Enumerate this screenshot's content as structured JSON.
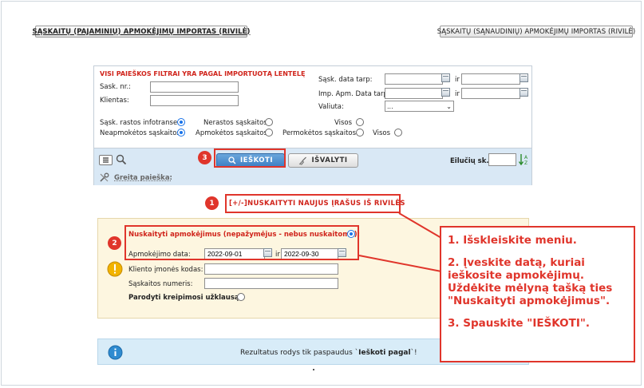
{
  "top": {
    "left_button": "SĄSKAITŲ (PAJAMINIŲ) APMOKĖJIMŲ IMPORTAS (RIVILĖ)",
    "right_button": "SĄSKAITŲ (SĄNAUDINIŲ) APMOKĖJIMŲ IMPORTAS (RIVILĖ)"
  },
  "filters": {
    "title": "VISI PAIEŠKOS FILTRAI YRA PAGAL IMPORTUOTĄ LENTELĘ",
    "invoice_no_label": "Sask. nr.:",
    "client_label": "Klientas:",
    "invoice_date_label": "Sąsk. data tarp:",
    "imp_date_label": "Imp. Apm. Data tarp:",
    "currency_label": "Valiuta:",
    "currency_value": "...",
    "between": "ir",
    "row1": {
      "opt1": "Sąsk. rastos infotranse",
      "opt2": "Nerastos sąskaitos",
      "opt3": "Visos"
    },
    "row2": {
      "opt1": "Neapmokėtos sąskaitos",
      "opt2": "Apmokėtos sąskaitos",
      "opt3": "Permokėtos sąskaitos",
      "opt4": "Visos"
    },
    "search_label": "IEŠKOTI",
    "clear_label": "IŠVALYTI",
    "rows_label": "Eilučių sk.:",
    "quick_search": "Greita paieška:"
  },
  "fetch_new": "[+/-]NUSKAITYTI NAUJUS ĮRAŠUS IŠ RIVILĖS",
  "fetch_panel": {
    "read_payments_label": "Nuskaityti apmokėjimus (nepažymėjus - nebus nuskaitoma):",
    "payment_date_label": "Apmokėjimo data:",
    "date_from": "2022-09-01",
    "between": "ir",
    "date_to": "2022-09-30",
    "company_code_label": "Kliento įmonės kodas:",
    "invoice_number_label": "Sąskaitos numeris:",
    "show_request_label": "Parodyti kreipimosi užklausą:"
  },
  "info": {
    "text_before": "Rezultatus rodys tik paspaudus `",
    "text_bold": "Ieškoti pagal",
    "text_after": "`!"
  },
  "badges": {
    "b1": "1",
    "b2": "2",
    "b3": "3"
  },
  "callout": {
    "step1": "1. Išskleiskite meniu.",
    "step2": "2. Įveskite datą, kuriai ieškosite apmokėjimų. Uždėkite mėlyną tašką ties \"Nuskaityti apmokėjimus\".",
    "step3": "3. Spauskite \"IEŠKOTI\"."
  },
  "colors": {
    "accent_red": "#e0352b",
    "primary_blue": "#3d7fc4",
    "panel_yellow": "#fdf6e0",
    "info_blue": "#d8ecf8"
  }
}
